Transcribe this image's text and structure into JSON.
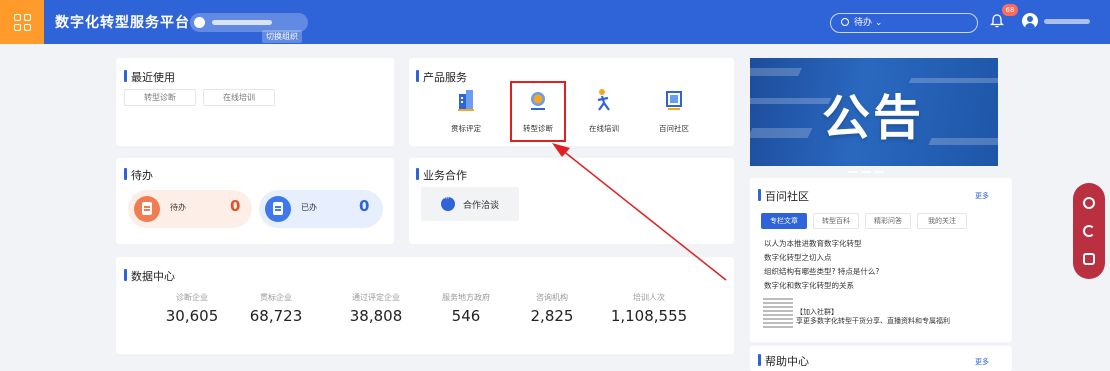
{
  "header": {
    "app_title": "数字化转型服务平台",
    "switch_org_label": "切换组织",
    "search_placeholder": "待办",
    "notification_count": "68",
    "colors": {
      "header_bg": "#2f63d8",
      "logo_bg": "#ff9a2b"
    }
  },
  "recent": {
    "title": "最近使用",
    "items": [
      "转型诊断",
      "在线培训"
    ]
  },
  "products": {
    "title": "产品服务",
    "items": [
      {
        "label": "贯标评定",
        "icon": "building-icon"
      },
      {
        "label": "转型诊断",
        "icon": "magnifier-icon"
      },
      {
        "label": "在线培训",
        "icon": "person-running-icon"
      },
      {
        "label": "百问社区",
        "icon": "picture-frame-icon"
      }
    ]
  },
  "todo": {
    "title": "待办",
    "pending_label": "待办",
    "pending_count": "0",
    "done_label": "已办",
    "done_count": "0"
  },
  "cooperation": {
    "title": "业务合作",
    "button_label": "合作洽谈"
  },
  "data_center": {
    "title": "数据中心",
    "stats": [
      {
        "label": "诊断企业",
        "value": "30,605"
      },
      {
        "label": "贯标企业",
        "value": "68,723"
      },
      {
        "label": "通过评定企业",
        "value": "38,808"
      },
      {
        "label": "服务地方政府",
        "value": "546"
      },
      {
        "label": "咨询机构",
        "value": "2,825"
      },
      {
        "label": "培训人次",
        "value": "1,108,555"
      }
    ]
  },
  "banner": {
    "text": "公告"
  },
  "community": {
    "title": "百问社区",
    "more_label": "更多",
    "tabs": [
      "专栏文章",
      "转型百科",
      "精彩问答",
      "我的关注"
    ],
    "articles": [
      "以人为本推进教育数字化转型",
      "数字化转型之切入点",
      "组织结构有哪些类型? 特点是什么?",
      "数字化和数字化转型的关系"
    ],
    "join_title": "【加入社群】",
    "join_desc": "享更多数字化转型干货分享、直播资料和专属福利"
  },
  "help": {
    "title": "帮助中心",
    "more_label": "更多"
  }
}
